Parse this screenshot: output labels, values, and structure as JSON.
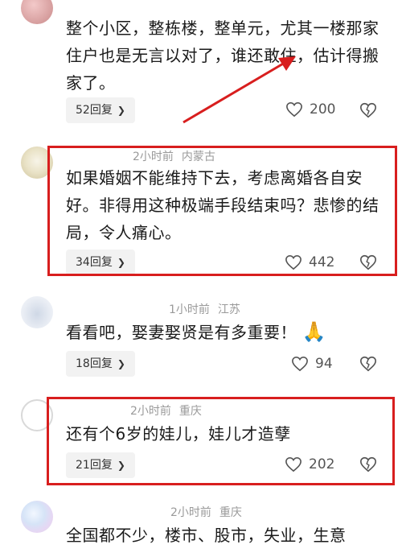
{
  "comments": [
    {
      "text": "整个小区，整栋楼，整单元，尤其一楼那家住户也是无言以对了，谁还敢住，估计得搬家了。",
      "reply": "52回复",
      "likes": "200"
    },
    {
      "time": "2小时前",
      "location": "内蒙古",
      "text": "如果婚姻不能维持下去，考虑离婚各自安好。非得用这种极端手段结束吗？悲惨的结局，令人痛心。",
      "reply": "34回复",
      "likes": "442"
    },
    {
      "time": "1小时前",
      "location": "江苏",
      "text": "看看吧，娶妻娶贤是有多重要！",
      "emoji": "🙏",
      "reply": "18回复",
      "likes": "94"
    },
    {
      "time": "2小时前",
      "location": "重庆",
      "text": "还有个6岁的娃儿，娃儿才造孽",
      "reply": "21回复",
      "likes": "202"
    },
    {
      "time": "2小时前",
      "location": "重庆",
      "text": "全国都不少，楼市、股市，失业，生意"
    }
  ],
  "colors": {
    "highlight": "#d81e1e",
    "meta": "#9a9a9a",
    "reply_bg": "#f2f2f2"
  },
  "icons": [
    "heart-icon",
    "dislike-heart-icon",
    "chevron-right-icon",
    "praying-hands-emoji"
  ]
}
